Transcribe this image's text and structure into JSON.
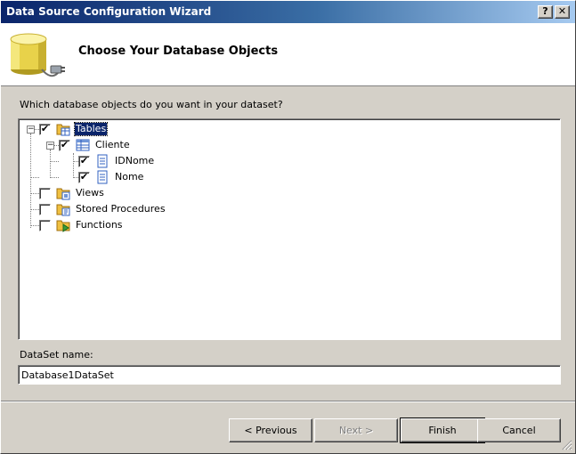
{
  "window": {
    "title": "Data Source Configuration Wizard",
    "help_label": "?",
    "close_label": "✕"
  },
  "header": {
    "title": "Choose Your Database Objects"
  },
  "prompt": "Which database objects do you want in your dataset?",
  "tree": [
    {
      "id": "tables",
      "label": "Tables",
      "checked": true,
      "expanded": true,
      "selected": true,
      "icon": "tables-folder-icon"
    },
    {
      "id": "cliente",
      "label": "Cliente",
      "checked": true,
      "expanded": true,
      "icon": "table-icon"
    },
    {
      "id": "idnome",
      "label": "IDNome",
      "checked": true,
      "icon": "column-icon"
    },
    {
      "id": "nome",
      "label": "Nome",
      "checked": true,
      "icon": "column-icon"
    },
    {
      "id": "views",
      "label": "Views",
      "checked": false,
      "icon": "views-folder-icon"
    },
    {
      "id": "stored-procedures",
      "label": "Stored Procedures",
      "checked": false,
      "icon": "procedures-folder-icon"
    },
    {
      "id": "functions",
      "label": "Functions",
      "checked": false,
      "icon": "functions-folder-icon"
    }
  ],
  "dataset": {
    "label": "DataSet name:",
    "value": "Database1DataSet"
  },
  "buttons": {
    "previous": "< Previous",
    "next": "Next >",
    "finish": "Finish",
    "cancel": "Cancel"
  },
  "colors": {
    "titlebar_start": "#0a246a",
    "titlebar_end": "#a6caf0",
    "face": "#d4d0c8",
    "selection": "#0a246a"
  }
}
